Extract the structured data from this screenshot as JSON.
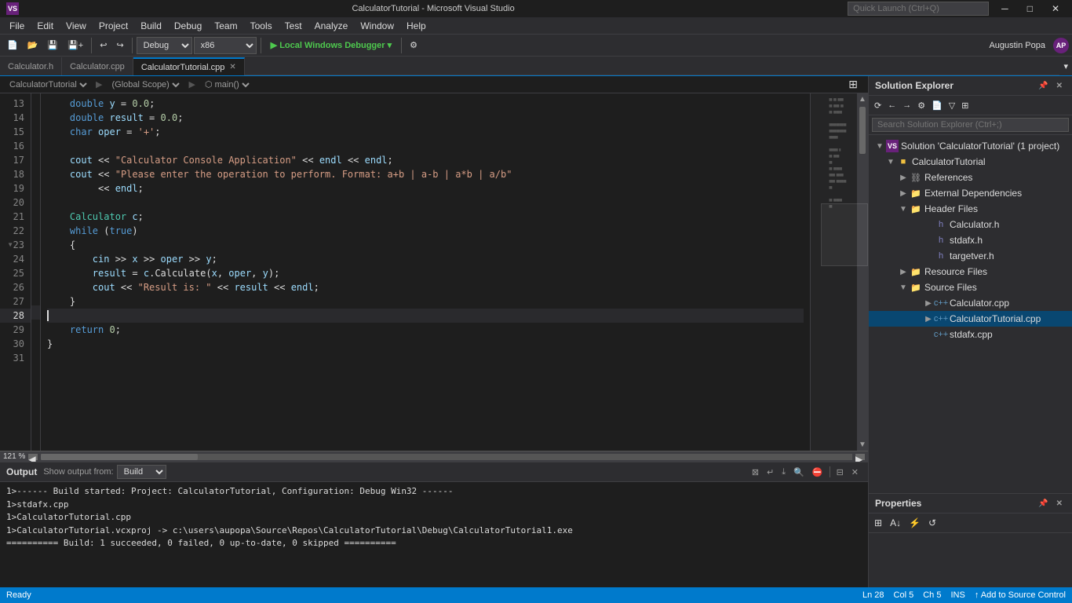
{
  "titlebar": {
    "title": "CalculatorTutorial - Microsoft Visual Studio",
    "vs_label": "VS",
    "minimize": "─",
    "restore": "□",
    "close": "✕",
    "quick_launch_placeholder": "Quick Launch (Ctrl+Q)"
  },
  "menubar": {
    "items": [
      "File",
      "Edit",
      "View",
      "Project",
      "Build",
      "Debug",
      "Team",
      "Tools",
      "Test",
      "Analyze",
      "Window",
      "Help"
    ]
  },
  "toolbar": {
    "debug_config": "Debug",
    "platform": "x86",
    "run_label": "▶ Local Windows Debugger",
    "user": "Augustin Popa"
  },
  "tabs": [
    {
      "label": "Calculator.h",
      "active": false,
      "closable": false
    },
    {
      "label": "Calculator.cpp",
      "active": false,
      "closable": false
    },
    {
      "label": "CalculatorTutorial.cpp",
      "active": true,
      "closable": true
    }
  ],
  "breadcrumb": {
    "project": "CalculatorTutorial",
    "scope": "(Global Scope)",
    "symbol": "main()"
  },
  "code": {
    "lines": [
      {
        "num": 13,
        "content": "    double y = 0.0;"
      },
      {
        "num": 14,
        "content": "    double result = 0.0;"
      },
      {
        "num": 15,
        "content": "    char oper = '+';"
      },
      {
        "num": 16,
        "content": ""
      },
      {
        "num": 17,
        "content": "    cout << \"Calculator Console Application\" << endl << endl;"
      },
      {
        "num": 18,
        "content": "    cout << \"Please enter the operation to perform. Format: a+b | a-b | a*b | a/b\""
      },
      {
        "num": 19,
        "content": "         << endl;"
      },
      {
        "num": 20,
        "content": ""
      },
      {
        "num": 21,
        "content": "    Calculator c;"
      },
      {
        "num": 22,
        "content": "    while (true)"
      },
      {
        "num": 23,
        "content": "    {"
      },
      {
        "num": 24,
        "content": "        cin >> x >> oper >> y;"
      },
      {
        "num": 25,
        "content": "        result = c.Calculate(x, oper, y);"
      },
      {
        "num": 26,
        "content": "        cout << \"Result is: \" << result << endl;"
      },
      {
        "num": 27,
        "content": "    }"
      },
      {
        "num": 28,
        "content": "",
        "current": true
      },
      {
        "num": 29,
        "content": "    return 0;"
      },
      {
        "num": 30,
        "content": "}"
      },
      {
        "num": 31,
        "content": ""
      }
    ]
  },
  "solution_explorer": {
    "title": "Solution Explorer",
    "search_placeholder": "Search Solution Explorer (Ctrl+;)",
    "tree": {
      "solution": "Solution 'CalculatorTutorial' (1 project)",
      "project": "CalculatorTutorial",
      "references": "References",
      "external_dependencies": "External Dependencies",
      "header_files": "Header Files",
      "header_files_items": [
        "Calculator.h",
        "stdafx.h",
        "targetver.h"
      ],
      "resource_files": "Resource Files",
      "source_files": "Source Files",
      "source_files_items": [
        "Calculator.cpp",
        "CalculatorTutorial.cpp",
        "stdafx.cpp"
      ]
    }
  },
  "properties": {
    "title": "Properties"
  },
  "output": {
    "title": "Output",
    "show_output_from_label": "Show output from:",
    "show_output_from_value": "Build",
    "lines": [
      "1>------ Build started: Project: CalculatorTutorial, Configuration: Debug Win32 ------",
      "1>stdafx.cpp",
      "1>CalculatorTutorial.cpp",
      "1>CalculatorTutorial.vcxproj -> c:\\users\\aupopa\\Source\\Repos\\CalculatorTutorial\\Debug\\CalculatorTutorial1.exe",
      "========== Build: 1 succeeded, 0 failed, 0 up-to-date, 0 skipped =========="
    ]
  },
  "statusbar": {
    "ready": "Ready",
    "ln": "Ln 28",
    "col": "Col 5",
    "ch": "Ch 5",
    "ins": "INS",
    "source_control": "↑ Add to Source Control"
  },
  "zoom": "121 %"
}
